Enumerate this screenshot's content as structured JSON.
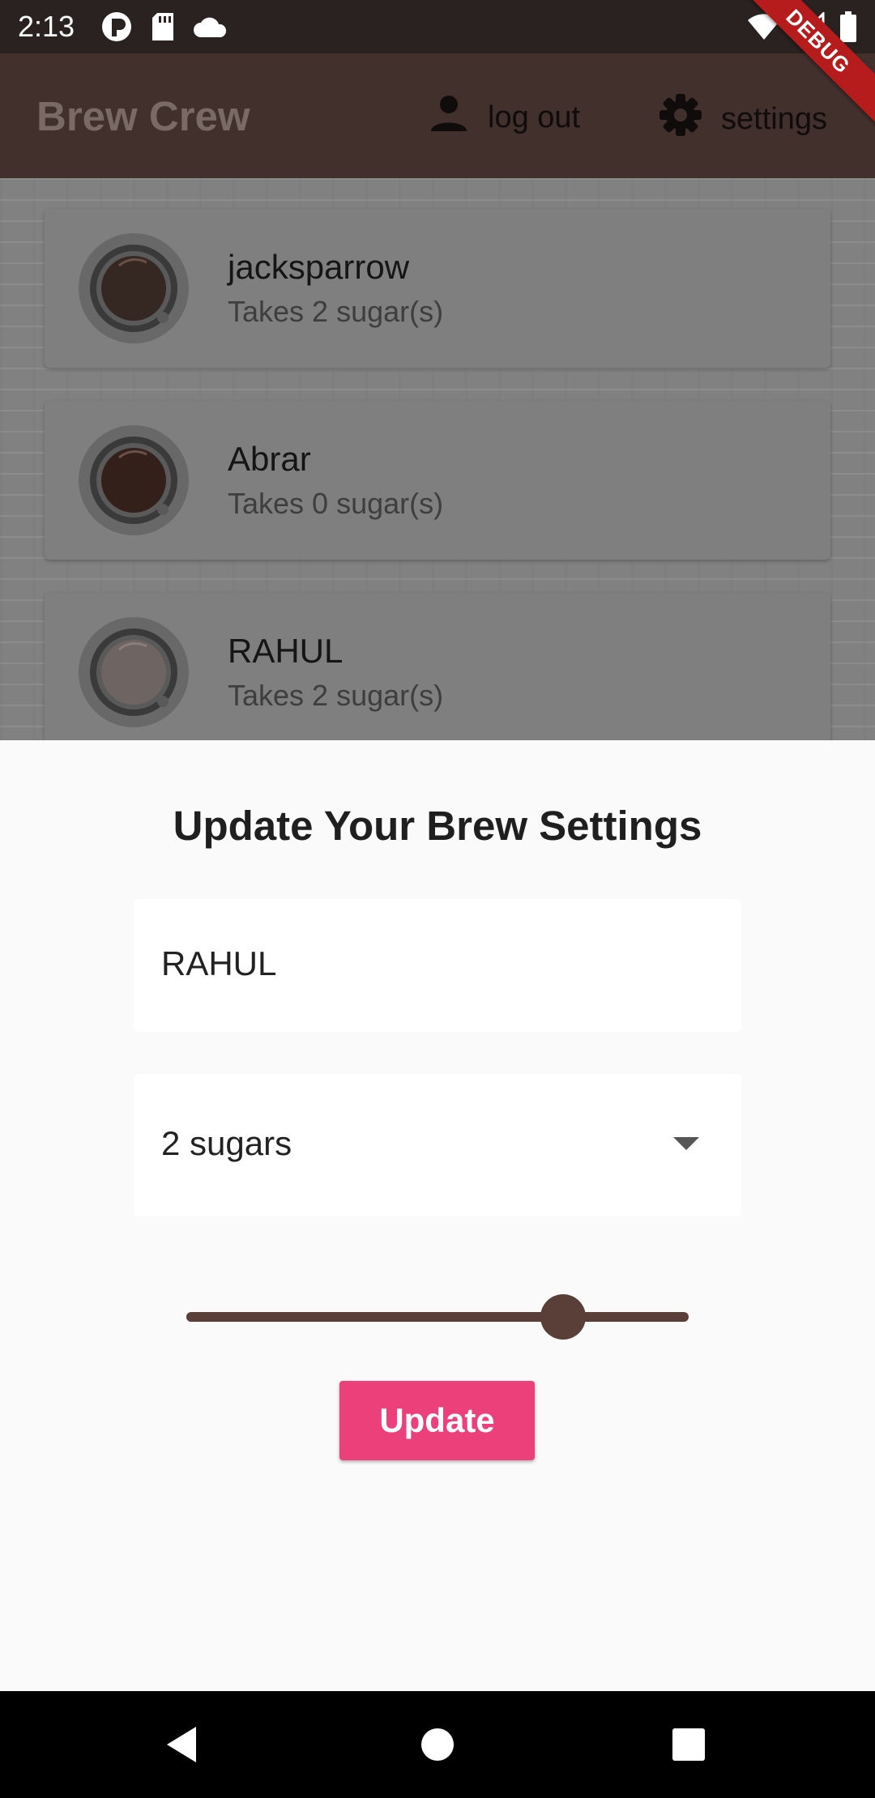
{
  "status_bar": {
    "time": "2:13",
    "left_icons": [
      "notification-app-icon",
      "sd-card-icon",
      "cloud-icon"
    ],
    "right_icons": [
      "wifi-icon",
      "cellular-signal-icon",
      "battery-icon"
    ],
    "debug_banner": "DEBUG"
  },
  "app_bar": {
    "title": "Brew Crew",
    "logout_label": "log out",
    "settings_label": "settings",
    "logout_icon": "person-icon",
    "settings_icon": "gear-icon"
  },
  "brews": [
    {
      "name": "jacksparrow",
      "subtitle": "Takes 2 sugar(s)"
    },
    {
      "name": "Abrar",
      "subtitle": "Takes 0 sugar(s)"
    },
    {
      "name": "RAHUL",
      "subtitle": "Takes 2 sugar(s)"
    }
  ],
  "sheet": {
    "title": "Update Your Brew Settings",
    "name_value": "RAHUL",
    "sugar_selected": "2 sugars",
    "strength_fraction": 0.75,
    "update_label": "Update"
  },
  "colors": {
    "app_bar": "#41302c",
    "accent_brown": "#5a3f39",
    "update_button": "#ec407a",
    "debug_banner": "#b71c1c"
  },
  "nav_bar": {
    "icons": [
      "back-icon",
      "home-icon",
      "recents-icon"
    ]
  }
}
